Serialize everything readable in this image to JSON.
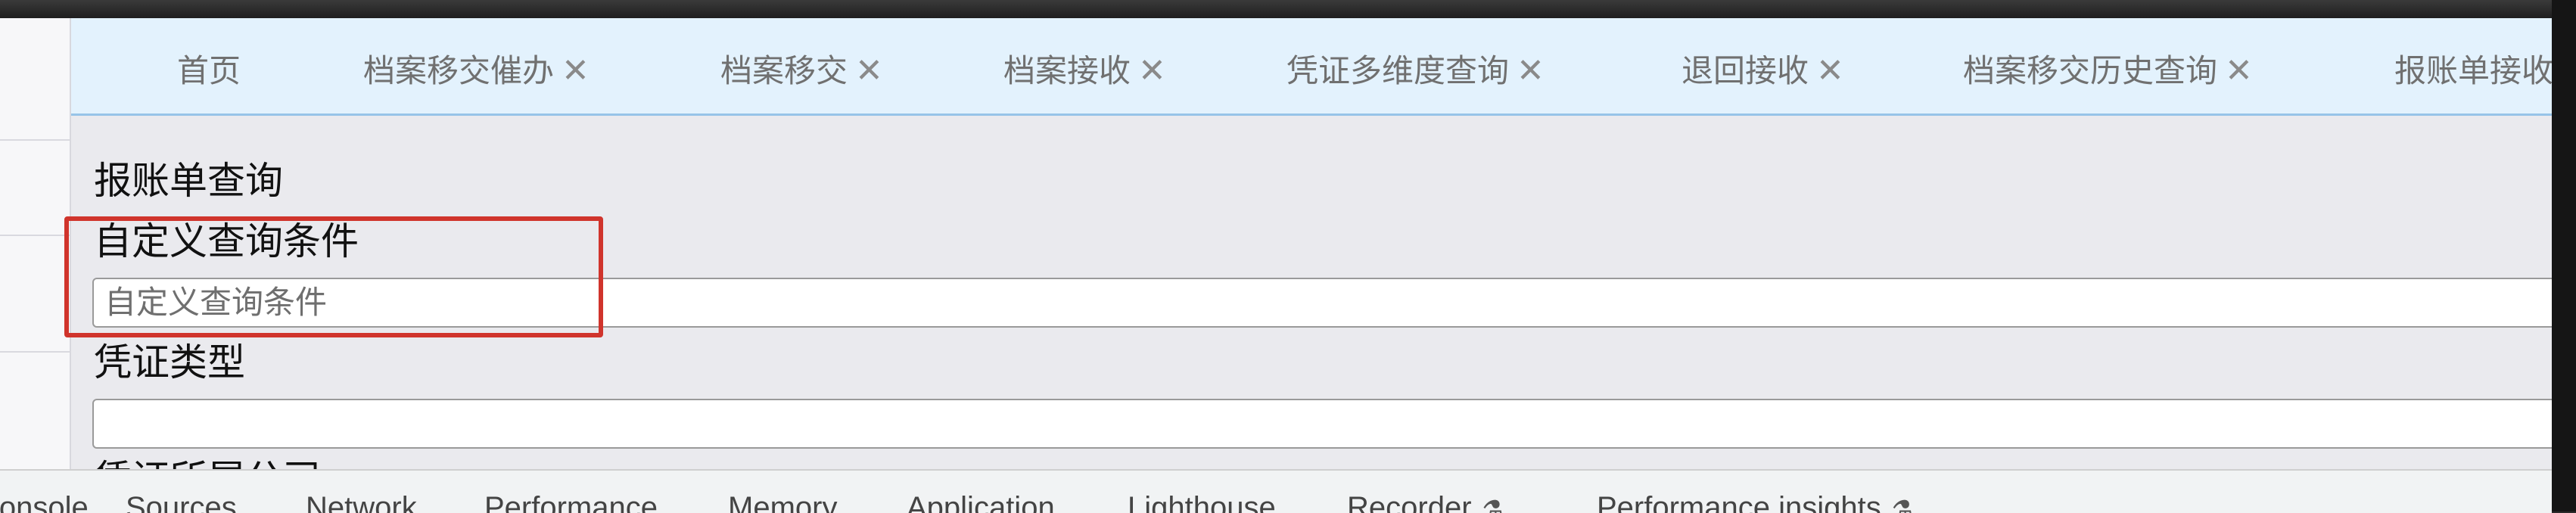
{
  "tabs": [
    {
      "label": "首页",
      "closable": false
    },
    {
      "label": "档案移交催办",
      "closable": true
    },
    {
      "label": "档案移交",
      "closable": true
    },
    {
      "label": "档案接收",
      "closable": true
    },
    {
      "label": "凭证多维度查询",
      "closable": true
    },
    {
      "label": "退回接收",
      "closable": true
    },
    {
      "label": "档案移交历史查询",
      "closable": true
    },
    {
      "label": "报账单接收",
      "closable": true
    }
  ],
  "close_glyph": "✕",
  "page": {
    "title": "报账单查询",
    "fields": [
      {
        "label": "自定义查询条件",
        "placeholder": "自定义查询条件",
        "value": ""
      },
      {
        "label": "凭证类型",
        "placeholder": "",
        "value": ""
      },
      {
        "label": "凭证所属公司"
      }
    ]
  },
  "devtools": {
    "tabs": [
      "Console",
      "Sources",
      "Network",
      "Performance",
      "Memory",
      "Application",
      "Lighthouse",
      "Recorder",
      "Performance insights"
    ],
    "beaker_icon": "⚗"
  },
  "colors": {
    "tabbar_bg": "#e3f2fd",
    "highlight": "#d0342c"
  }
}
